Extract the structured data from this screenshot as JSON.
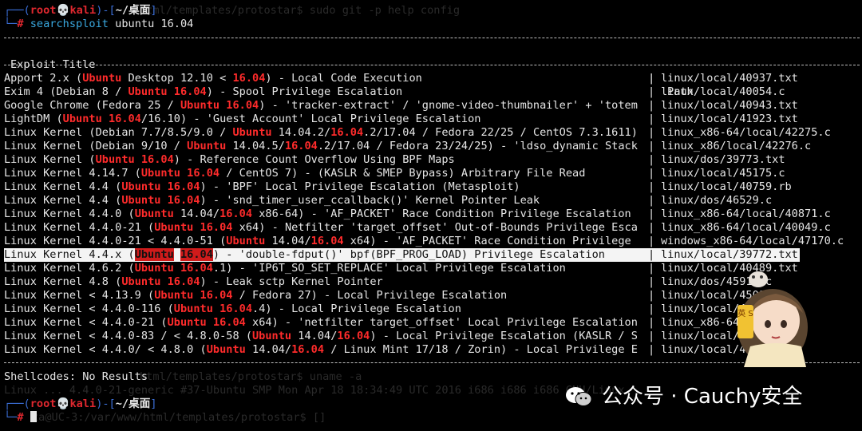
{
  "ghost_lines": [
    "html/templates/protostar$ sudo git -p help config",
    "html/templates/protostar$ uname -a",
    "Linux ... 4.4.0-21-generic #37-Ubuntu SMP Mon Apr 18 18:34:49 UTC 2016 i686 i686 i686 GNU/Linux",
    "ta@UC-3:/var/www/html/templates/protostar$ []"
  ],
  "prompt": {
    "open": "┌──(",
    "user": "root",
    "skull": "💀",
    "host": "kali",
    "mid": ")-[",
    "dir": "~/桌面",
    "close": "]",
    "second": "└─",
    "hash": "#"
  },
  "command": {
    "name": "searchsploit",
    "args": " ubuntu 16.04"
  },
  "header": {
    "title": "Exploit Title",
    "pipe": "|",
    "path": "Path"
  },
  "rows": [
    {
      "segs": [
        "Apport 2.x (",
        "#Ubuntu",
        " Desktop 12.10 < ",
        "#16.04",
        ") - Local Code Execution"
      ],
      "path": "linux/local/40937.txt"
    },
    {
      "segs": [
        "Exim 4 (Debian 8 / ",
        "#Ubuntu 16.04",
        ") - Spool Privilege Escalation"
      ],
      "path": "linux/local/40054.c"
    },
    {
      "segs": [
        "Google Chrome (Fedora 25 / ",
        "#Ubuntu 16.04",
        ") - 'tracker-extract' / 'gnome-video-thumbnailer' + 'totem"
      ],
      "path": "linux/local/40943.txt"
    },
    {
      "segs": [
        "LightDM (",
        "#Ubuntu 16.04",
        "/16.10) - 'Guest Account' Local Privilege Escalation"
      ],
      "path": "linux/local/41923.txt"
    },
    {
      "segs": [
        "Linux Kernel (Debian 7.7/8.5/9.0 / ",
        "#Ubuntu",
        " 14.04.2/",
        "#16.04",
        ".2/17.04 / Fedora 22/25 / CentOS 7.3.1611)"
      ],
      "path": "linux_x86-64/local/42275.c"
    },
    {
      "segs": [
        "Linux Kernel (Debian 9/10 / ",
        "#Ubuntu",
        " 14.04.5/",
        "#16.04",
        ".2/17.04 / Fedora 23/24/25) - 'ldso_dynamic Stack"
      ],
      "path": "linux_x86/local/42276.c"
    },
    {
      "segs": [
        "Linux Kernel (",
        "#Ubuntu 16.04",
        ") - Reference Count Overflow Using BPF Maps"
      ],
      "path": "linux/dos/39773.txt"
    },
    {
      "segs": [
        "Linux Kernel 4.14.7 (",
        "#Ubuntu 16.04",
        " / CentOS 7) - (KASLR & SMEP Bypass) Arbitrary File Read"
      ],
      "path": "linux/local/45175.c"
    },
    {
      "segs": [
        "Linux Kernel 4.4 (",
        "#Ubuntu 16.04",
        ") - 'BPF' Local Privilege Escalation (Metasploit)"
      ],
      "path": "linux/local/40759.rb"
    },
    {
      "segs": [
        "Linux Kernel 4.4 (",
        "#Ubuntu 16.04",
        ") - 'snd_timer_user_ccallback()' Kernel Pointer Leak"
      ],
      "path": "linux/dos/46529.c"
    },
    {
      "segs": [
        "Linux Kernel 4.4.0 (",
        "#Ubuntu",
        " 14.04/",
        "#16.04",
        " x86-64) - 'AF_PACKET' Race Condition Privilege Escalation"
      ],
      "path": "linux_x86-64/local/40871.c"
    },
    {
      "segs": [
        "Linux Kernel 4.4.0-21 (",
        "#Ubuntu 16.04",
        " x64) - Netfilter 'target_offset' Out-of-Bounds Privilege Esca"
      ],
      "path": "linux_x86-64/local/40049.c"
    },
    {
      "segs": [
        "Linux Kernel 4.4.0-21 < 4.4.0-51 (",
        "#Ubuntu",
        " 14.04/",
        "#16.04",
        " x64) - 'AF_PACKET' Race Condition Privilege"
      ],
      "path": "windows_x86-64/local/47170.c"
    },
    {
      "segs": [
        "Linux Kernel 4.4.x (",
        "#Ubuntu",
        " ",
        "#16.04",
        ") - 'double-fdput()' bpf(BPF_PROG_LOAD) Privilege Escalation"
      ],
      "path": "linux/local/39772.txt",
      "selected": true
    },
    {
      "segs": [
        "Linux Kernel 4.6.2 (",
        "#Ubuntu 16.04",
        ".1) - 'IP6T_SO_SET_REPLACE' Local Privilege Escalation"
      ],
      "path": "linux/local/40489.txt"
    },
    {
      "segs": [
        "Linux Kernel 4.8 (",
        "#Ubuntu 16.04",
        ") - Leak sctp Kernel Pointer"
      ],
      "path": "linux/dos/45919.c"
    },
    {
      "segs": [
        "Linux Kernel < 4.13.9 (",
        "#Ubuntu 16.04",
        " / Fedora 27) - Local Privilege Escalation"
      ],
      "path": "linux/local/4501"
    },
    {
      "segs": [
        "Linux Kernel < 4.4.0-116 (",
        "#Ubuntu 16.04",
        ".4) - Local Privilege Escalation"
      ],
      "path": "linux/local/44"
    },
    {
      "segs": [
        "Linux Kernel < 4.4.0-21 (",
        "#Ubuntu 16.04",
        " x64) - 'netfilter target_offset' Local Privilege Escalation"
      ],
      "path": "linux_x86-64/"
    },
    {
      "segs": [
        "Linux Kernel < 4.4.0-83 / < 4.8.0-58 (",
        "#Ubuntu",
        " 14.04/",
        "#16.04",
        ") - Local Privilege Escalation (KASLR / S"
      ],
      "path": "linux/local/43"
    },
    {
      "segs": [
        "Linux Kernel < 4.4.0/ < 4.8.0 (",
        "#Ubuntu",
        " 14.04/",
        "#16.04",
        " / Linux Mint 17/18 / Zorin) - Local Privilege E"
      ],
      "path": "linux/local/47"
    }
  ],
  "shellcodes": "Shellcodes: No Results",
  "watermark": {
    "text": "公众号 · Cauchy安全",
    "icon": "wechat-icon"
  },
  "avatar": {
    "icon": "anime-girl-avatar",
    "badge": "英 S"
  },
  "colors": {
    "background": "#000000",
    "text": "#e6e6e6",
    "highlight": "#ff2b2b",
    "prompt_frame": "#3b6fd8",
    "prompt_user": "#e0282f",
    "command": "#3aa9e0"
  }
}
